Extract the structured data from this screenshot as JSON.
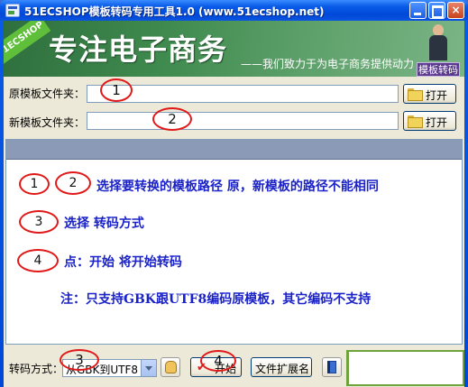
{
  "window": {
    "title": "51ECSHOP模板转码专用工具1.0 (www.51ecshop.net)",
    "controls": {
      "minimize": "",
      "maximize": "",
      "close": "×"
    }
  },
  "banner": {
    "logo_text": "51ECSHOP",
    "heading": "专注电子商务",
    "slogan": "——我们致力于为电子商务提供动力",
    "badge": "模板转码"
  },
  "form": {
    "source_label": "原模板文件夹：",
    "source_value": "",
    "target_label": "新模板文件夹：",
    "target_value": "",
    "open_label": "打开"
  },
  "annotations": {
    "one": "1",
    "two": "2",
    "three": "3",
    "four": "4"
  },
  "log": {
    "line1": "选择要转换的模板路径 原，新模板的路径不能相同",
    "line2": "选择 转码方式",
    "line3": "点：开始 将开始转码",
    "line4": "注：只支持GBK跟UTF8编码原模板，其它编码不支持"
  },
  "bottom": {
    "mode_label": "转码方式：",
    "mode_selected": "从GBK到UTF8",
    "start_label": "开始",
    "ext_label": "文件扩展名"
  },
  "colors": {
    "title_bar": "#0a5ce8",
    "banner_green": "#3f8a4e",
    "annotation_red": "#e01818",
    "log_text_blue": "#1a22c8"
  },
  "icons": [
    "app-icon",
    "minimize-icon",
    "maximize-icon",
    "close-icon",
    "folder-icon",
    "hand-icon",
    "checkmark-icon",
    "book-icon"
  ]
}
